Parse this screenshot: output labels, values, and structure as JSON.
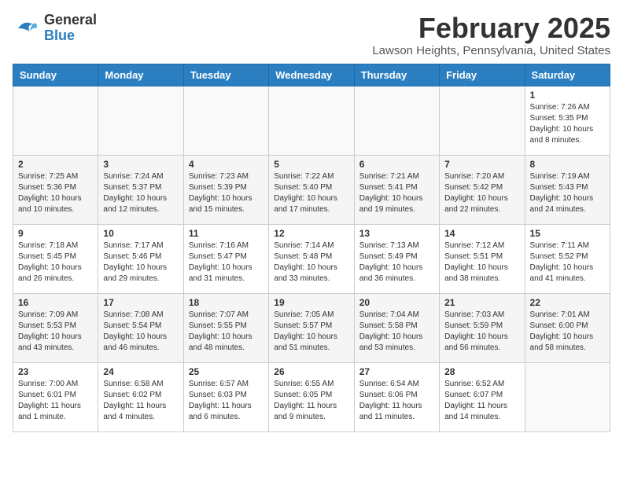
{
  "header": {
    "logo_general": "General",
    "logo_blue": "Blue",
    "month_title": "February 2025",
    "location": "Lawson Heights, Pennsylvania, United States"
  },
  "days_of_week": [
    "Sunday",
    "Monday",
    "Tuesday",
    "Wednesday",
    "Thursday",
    "Friday",
    "Saturday"
  ],
  "weeks": [
    [
      {
        "day": "",
        "info": ""
      },
      {
        "day": "",
        "info": ""
      },
      {
        "day": "",
        "info": ""
      },
      {
        "day": "",
        "info": ""
      },
      {
        "day": "",
        "info": ""
      },
      {
        "day": "",
        "info": ""
      },
      {
        "day": "1",
        "info": "Sunrise: 7:26 AM\nSunset: 5:35 PM\nDaylight: 10 hours and 8 minutes."
      }
    ],
    [
      {
        "day": "2",
        "info": "Sunrise: 7:25 AM\nSunset: 5:36 PM\nDaylight: 10 hours and 10 minutes."
      },
      {
        "day": "3",
        "info": "Sunrise: 7:24 AM\nSunset: 5:37 PM\nDaylight: 10 hours and 12 minutes."
      },
      {
        "day": "4",
        "info": "Sunrise: 7:23 AM\nSunset: 5:39 PM\nDaylight: 10 hours and 15 minutes."
      },
      {
        "day": "5",
        "info": "Sunrise: 7:22 AM\nSunset: 5:40 PM\nDaylight: 10 hours and 17 minutes."
      },
      {
        "day": "6",
        "info": "Sunrise: 7:21 AM\nSunset: 5:41 PM\nDaylight: 10 hours and 19 minutes."
      },
      {
        "day": "7",
        "info": "Sunrise: 7:20 AM\nSunset: 5:42 PM\nDaylight: 10 hours and 22 minutes."
      },
      {
        "day": "8",
        "info": "Sunrise: 7:19 AM\nSunset: 5:43 PM\nDaylight: 10 hours and 24 minutes."
      }
    ],
    [
      {
        "day": "9",
        "info": "Sunrise: 7:18 AM\nSunset: 5:45 PM\nDaylight: 10 hours and 26 minutes."
      },
      {
        "day": "10",
        "info": "Sunrise: 7:17 AM\nSunset: 5:46 PM\nDaylight: 10 hours and 29 minutes."
      },
      {
        "day": "11",
        "info": "Sunrise: 7:16 AM\nSunset: 5:47 PM\nDaylight: 10 hours and 31 minutes."
      },
      {
        "day": "12",
        "info": "Sunrise: 7:14 AM\nSunset: 5:48 PM\nDaylight: 10 hours and 33 minutes."
      },
      {
        "day": "13",
        "info": "Sunrise: 7:13 AM\nSunset: 5:49 PM\nDaylight: 10 hours and 36 minutes."
      },
      {
        "day": "14",
        "info": "Sunrise: 7:12 AM\nSunset: 5:51 PM\nDaylight: 10 hours and 38 minutes."
      },
      {
        "day": "15",
        "info": "Sunrise: 7:11 AM\nSunset: 5:52 PM\nDaylight: 10 hours and 41 minutes."
      }
    ],
    [
      {
        "day": "16",
        "info": "Sunrise: 7:09 AM\nSunset: 5:53 PM\nDaylight: 10 hours and 43 minutes."
      },
      {
        "day": "17",
        "info": "Sunrise: 7:08 AM\nSunset: 5:54 PM\nDaylight: 10 hours and 46 minutes."
      },
      {
        "day": "18",
        "info": "Sunrise: 7:07 AM\nSunset: 5:55 PM\nDaylight: 10 hours and 48 minutes."
      },
      {
        "day": "19",
        "info": "Sunrise: 7:05 AM\nSunset: 5:57 PM\nDaylight: 10 hours and 51 minutes."
      },
      {
        "day": "20",
        "info": "Sunrise: 7:04 AM\nSunset: 5:58 PM\nDaylight: 10 hours and 53 minutes."
      },
      {
        "day": "21",
        "info": "Sunrise: 7:03 AM\nSunset: 5:59 PM\nDaylight: 10 hours and 56 minutes."
      },
      {
        "day": "22",
        "info": "Sunrise: 7:01 AM\nSunset: 6:00 PM\nDaylight: 10 hours and 58 minutes."
      }
    ],
    [
      {
        "day": "23",
        "info": "Sunrise: 7:00 AM\nSunset: 6:01 PM\nDaylight: 11 hours and 1 minute."
      },
      {
        "day": "24",
        "info": "Sunrise: 6:58 AM\nSunset: 6:02 PM\nDaylight: 11 hours and 4 minutes."
      },
      {
        "day": "25",
        "info": "Sunrise: 6:57 AM\nSunset: 6:03 PM\nDaylight: 11 hours and 6 minutes."
      },
      {
        "day": "26",
        "info": "Sunrise: 6:55 AM\nSunset: 6:05 PM\nDaylight: 11 hours and 9 minutes."
      },
      {
        "day": "27",
        "info": "Sunrise: 6:54 AM\nSunset: 6:06 PM\nDaylight: 11 hours and 11 minutes."
      },
      {
        "day": "28",
        "info": "Sunrise: 6:52 AM\nSunset: 6:07 PM\nDaylight: 11 hours and 14 minutes."
      },
      {
        "day": "",
        "info": ""
      }
    ]
  ]
}
